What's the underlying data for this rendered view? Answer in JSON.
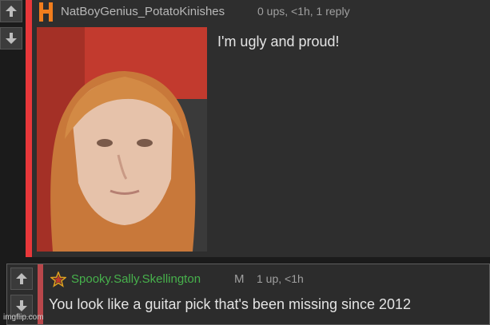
{
  "comments": [
    {
      "username": "NatBoyGenius_PotatoKinishes",
      "meta": "0 ups, <1h, 1 reply",
      "text": "I'm ugly and proud!",
      "badge_color": "#f07d1d",
      "bar_color": "#e8373a",
      "has_image": true
    },
    {
      "username": "Spooky.Sally.Skellington",
      "mod_tag": "M",
      "meta": "1 up, <1h",
      "text": "You look like a guitar pick that's been missing since 2012",
      "badge_icon": "star-icon",
      "username_color": "#47b14c",
      "bar_color": "#b9474b"
    }
  ],
  "watermark": "imgflip.com"
}
